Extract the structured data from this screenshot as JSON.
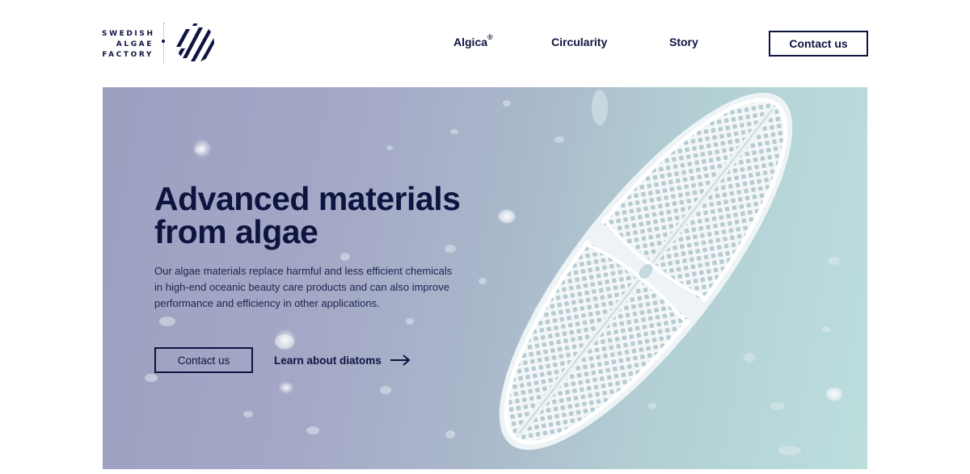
{
  "brand": {
    "logo_lines": [
      "SWEDISH",
      "ALGAE",
      "FACTORY"
    ],
    "logo_icon": "diagonal-stripes-circle-icon"
  },
  "nav": {
    "items": [
      {
        "label": "Algica",
        "sup": "®"
      },
      {
        "label": "Circularity"
      },
      {
        "label": "Story"
      }
    ],
    "contact_label": "Contact us"
  },
  "hero": {
    "title_line1": "Advanced materials",
    "title_line2": "from algae",
    "description_lines": [
      "Our algae materials replace harmful and less efficient chemicals",
      "in high-end oceanic beauty care products and can also improve",
      "performance and efficiency in other applications."
    ],
    "primary_cta": "Contact us",
    "secondary_cta": "Learn about diatoms",
    "secondary_icon": "arrow-right-icon",
    "image": "diatom-microscope-image"
  },
  "colors": {
    "navy": "#0e1440",
    "hero_left": "#9d9fc0",
    "hero_right": "#bcdedd"
  }
}
